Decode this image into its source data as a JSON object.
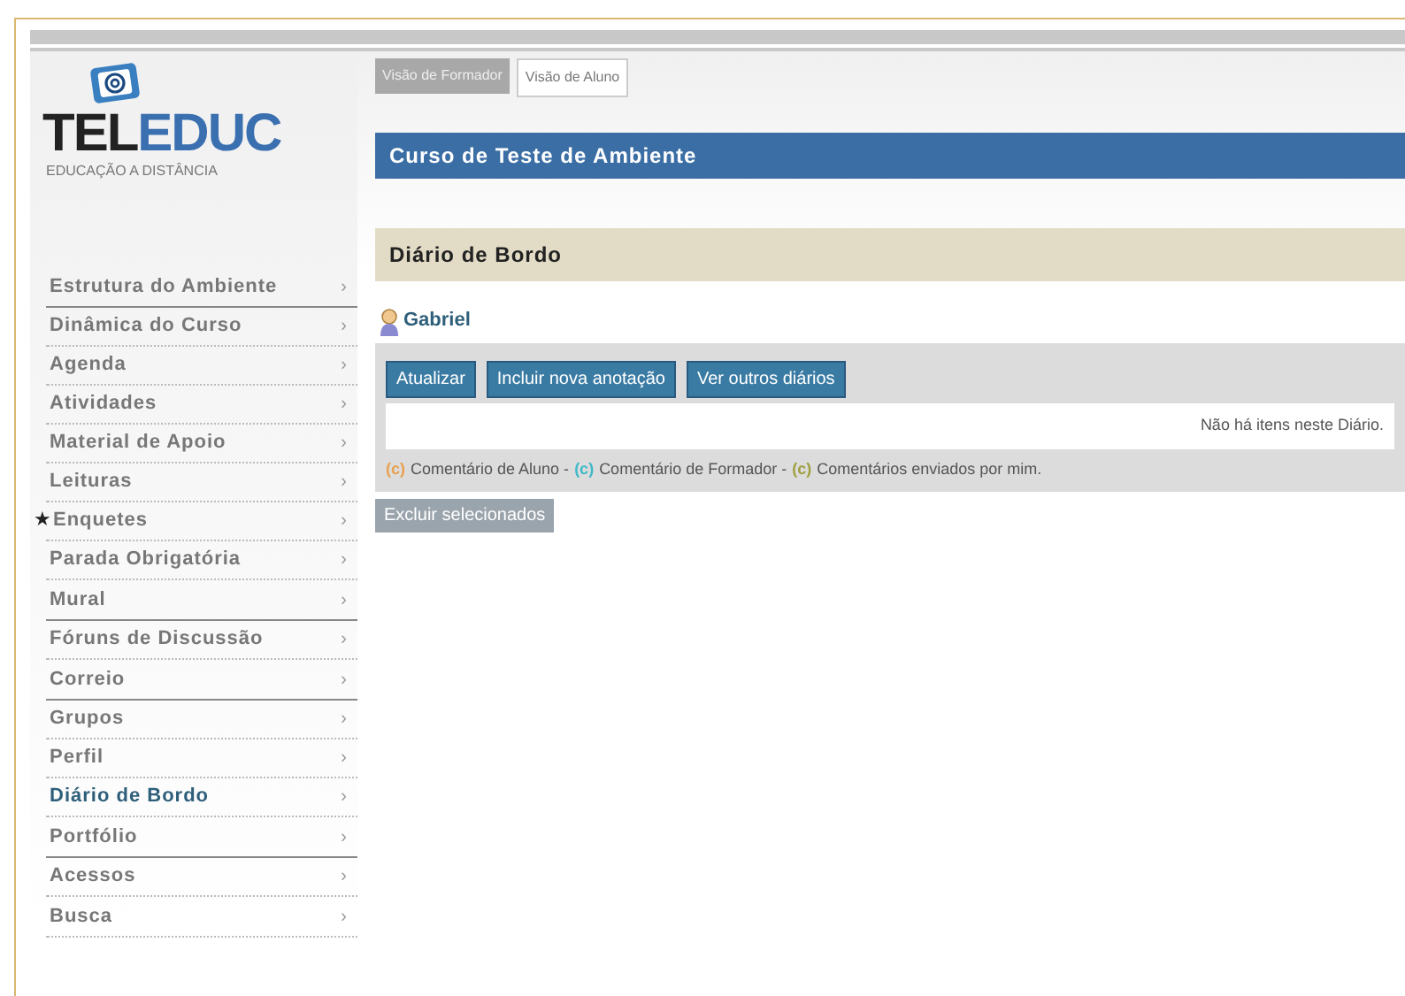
{
  "logo": {
    "title_dark": "TEL",
    "title_blue": "EDUC",
    "tagline": "EDUCAÇÃO A DISTÂNCIA"
  },
  "views": [
    {
      "label": "Visão de Formador",
      "selected": true
    },
    {
      "label": "Visão de Aluno",
      "selected": false
    }
  ],
  "course_title": "Curso de Teste de Ambiente",
  "menu_groups": [
    [
      {
        "label": "Estrutura do Ambiente",
        "selected": false,
        "starred": false
      }
    ],
    [
      {
        "label": "Dinâmica do Curso",
        "selected": false,
        "starred": false
      },
      {
        "label": "Agenda",
        "selected": false,
        "starred": false
      },
      {
        "label": "Atividades",
        "selected": false,
        "starred": false
      },
      {
        "label": "Material de Apoio",
        "selected": false,
        "starred": false
      },
      {
        "label": "Leituras",
        "selected": false,
        "starred": false
      },
      {
        "label": "Enquetes",
        "selected": false,
        "starred": true
      },
      {
        "label": "Parada Obrigatória",
        "selected": false,
        "starred": false
      },
      {
        "label": "Mural",
        "selected": false,
        "starred": false
      }
    ],
    [
      {
        "label": "Fóruns de Discussão",
        "selected": false,
        "starred": false
      },
      {
        "label": "Correio",
        "selected": false,
        "starred": false
      }
    ],
    [
      {
        "label": "Grupos",
        "selected": false,
        "starred": false
      },
      {
        "label": "Perfil",
        "selected": false,
        "starred": false
      },
      {
        "label": "Diário de Bordo",
        "selected": true,
        "starred": false
      },
      {
        "label": "Portfólio",
        "selected": false,
        "starred": false
      }
    ],
    [
      {
        "label": "Acessos",
        "selected": false,
        "starred": false
      },
      {
        "label": "Busca",
        "selected": false,
        "starred": false
      }
    ]
  ],
  "chevron": "›",
  "star": "★",
  "section_title": "Diário de Bordo",
  "user": "Gabriel",
  "actions": [
    "Atualizar",
    "Incluir nova anotação",
    "Ver outros diários"
  ],
  "empty_message": "Não há itens neste Diário.",
  "legend": [
    {
      "mark": "(c)",
      "label": "Comentário de Aluno -",
      "color": "#e8a050"
    },
    {
      "mark": "(c)",
      "label": "Comentário de Formador -",
      "color": "#40b8c8"
    },
    {
      "mark": "(c)",
      "label": "Comentários enviados por mim.",
      "color": "#a0a040"
    }
  ],
  "delete_button": "Excluir selecionados"
}
